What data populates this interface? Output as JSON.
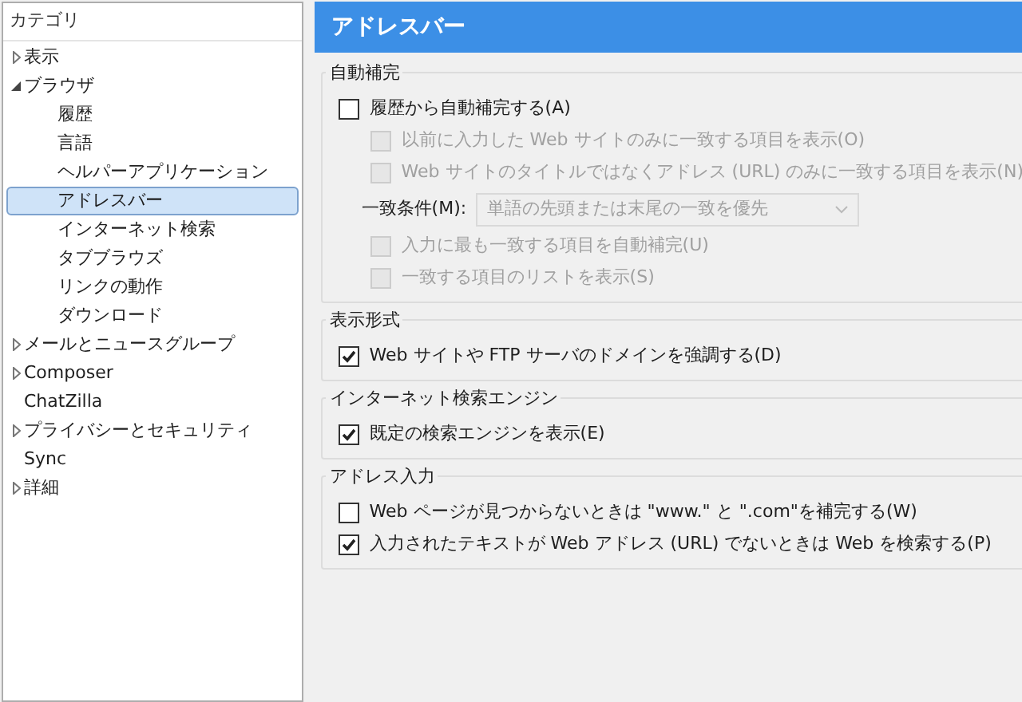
{
  "sidebar": {
    "header": "カテゴリ",
    "items": [
      {
        "label": "表示",
        "expanded": false,
        "selected": false
      },
      {
        "label": "ブラウザ",
        "expanded": true,
        "selected": false,
        "children": [
          {
            "label": "履歴",
            "selected": false
          },
          {
            "label": "言語",
            "selected": false
          },
          {
            "label": "ヘルパーアプリケーション",
            "selected": false
          },
          {
            "label": "アドレスバー",
            "selected": true
          },
          {
            "label": "インターネット検索",
            "selected": false
          },
          {
            "label": "タブブラウズ",
            "selected": false
          },
          {
            "label": "リンクの動作",
            "selected": false
          },
          {
            "label": "ダウンロード",
            "selected": false
          }
        ]
      },
      {
        "label": "メールとニュースグループ",
        "expanded": false,
        "selected": false
      },
      {
        "label": "Composer",
        "expanded": false,
        "selected": false
      },
      {
        "label": "ChatZilla",
        "selected": false
      },
      {
        "label": "プライバシーとセキュリティ",
        "expanded": false,
        "selected": false
      },
      {
        "label": "Sync",
        "selected": false
      },
      {
        "label": "詳細",
        "expanded": false,
        "selected": false
      }
    ]
  },
  "panel": {
    "title": "アドレスバー",
    "groups": [
      {
        "legend": "自動補完",
        "options": [
          {
            "kind": "checkbox",
            "label": "履歴から自動補完する(A)",
            "checked": false,
            "disabled": false,
            "children": [
              {
                "kind": "checkbox",
                "label": "以前に入力した Web サイトのみに一致する項目を表示(O)",
                "checked": false,
                "disabled": true
              },
              {
                "kind": "checkbox",
                "label": "Web サイトのタイトルではなくアドレス (URL) のみに一致する項目を表示(N)",
                "checked": false,
                "disabled": true
              },
              {
                "kind": "select",
                "label": "一致条件(M):",
                "value": "単語の先頭または末尾の一致を優先",
                "disabled": true
              },
              {
                "kind": "checkbox",
                "label": "入力に最も一致する項目を自動補完(U)",
                "checked": false,
                "disabled": true
              },
              {
                "kind": "checkbox",
                "label": "一致する項目のリストを表示(S)",
                "checked": false,
                "disabled": true
              }
            ]
          }
        ]
      },
      {
        "legend": "表示形式",
        "options": [
          {
            "kind": "checkbox",
            "label": "Web サイトや FTP サーバのドメインを強調する(D)",
            "checked": true,
            "disabled": false
          }
        ]
      },
      {
        "legend": "インターネット検索エンジン",
        "options": [
          {
            "kind": "checkbox",
            "label": "既定の検索エンジンを表示(E)",
            "checked": true,
            "disabled": false
          }
        ]
      },
      {
        "legend": "アドレス入力",
        "options": [
          {
            "kind": "checkbox",
            "label": "Web ページが見つからないときは \"www.\" と \".com\"を補完する(W)",
            "checked": false,
            "disabled": false
          },
          {
            "kind": "checkbox",
            "label": "入力されたテキストが Web アドレス (URL) でないときは Web を検索する(P)",
            "checked": true,
            "disabled": false
          }
        ]
      }
    ]
  }
}
